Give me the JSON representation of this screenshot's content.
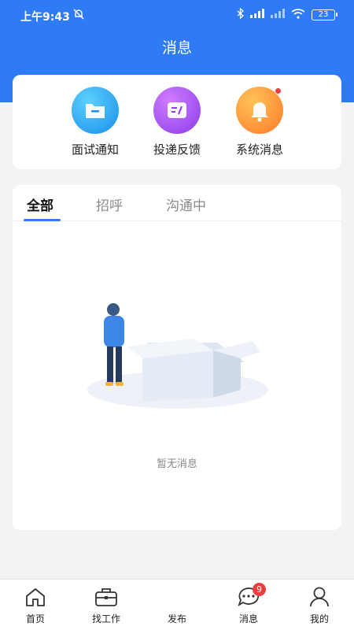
{
  "status_bar": {
    "time": "上午9:43",
    "battery": "23"
  },
  "nav": {
    "title": "消息"
  },
  "quick_actions": [
    {
      "label": "面试通知",
      "icon": "folder-icon",
      "color": "#1ea7ee",
      "badge": false
    },
    {
      "label": "投递反馈",
      "icon": "feedback-icon",
      "color": "#a34ff0",
      "badge": false
    },
    {
      "label": "系统消息",
      "icon": "bell-icon",
      "color": "#ff8a2c",
      "badge": true
    }
  ],
  "tabs": [
    {
      "label": "全部",
      "active": true
    },
    {
      "label": "招呼",
      "active": false
    },
    {
      "label": "沟通中",
      "active": false
    }
  ],
  "empty_state": {
    "text": "暂无消息"
  },
  "tabbar": [
    {
      "label": "首页",
      "icon": "home-icon"
    },
    {
      "label": "找工作",
      "icon": "briefcase-icon"
    },
    {
      "label": "发布",
      "icon": "publish-icon"
    },
    {
      "label": "消息",
      "icon": "chat-icon",
      "badge": "9"
    },
    {
      "label": "我的",
      "icon": "user-icon"
    }
  ],
  "colors": {
    "primary": "#2f7bf5",
    "badge": "#f03c3c"
  }
}
